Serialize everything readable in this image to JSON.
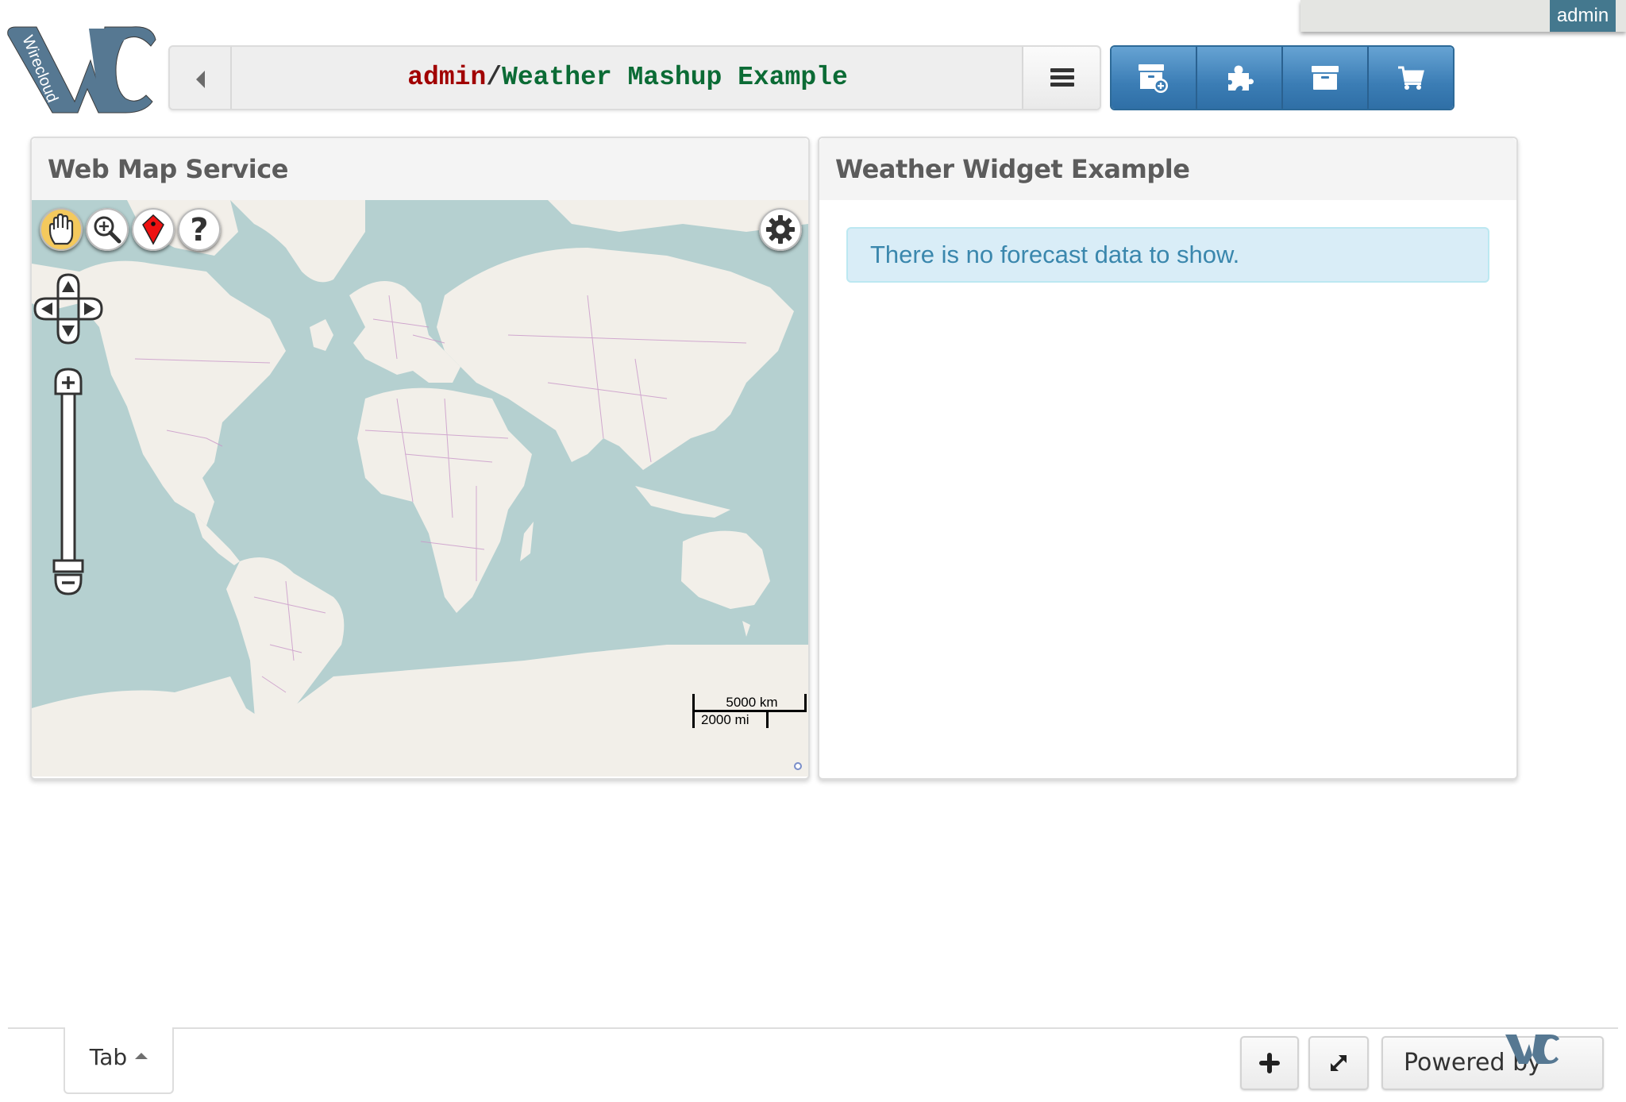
{
  "user_bar": {
    "username": "admin"
  },
  "logo": {
    "text": "Wirecloud",
    "icon": "wirecloud-logo"
  },
  "header": {
    "back_icon": "caret-left-icon",
    "owner": "admin",
    "separator": "/",
    "workspace": "Weather Mashup Example",
    "menu_icon": "hamburger-menu-icon",
    "toolbar": [
      {
        "name": "add-widget",
        "icon": "archive-add-icon"
      },
      {
        "name": "wiring",
        "icon": "puzzle-icon"
      },
      {
        "name": "my-resources",
        "icon": "archive-icon"
      },
      {
        "name": "marketplace",
        "icon": "shopping-cart-icon"
      }
    ]
  },
  "widgets": {
    "wms": {
      "title": "Web Map Service",
      "tools": [
        {
          "name": "pan",
          "icon": "hand-icon",
          "active": true
        },
        {
          "name": "zoom-box",
          "icon": "zoom-in-icon",
          "active": false
        },
        {
          "name": "marker",
          "icon": "map-marker-icon",
          "active": false
        },
        {
          "name": "help",
          "icon": "question-icon",
          "active": false
        }
      ],
      "settings_icon": "gear-icon",
      "pan_controls": [
        "up",
        "left",
        "right",
        "down"
      ],
      "zoom_controls": {
        "in": "+",
        "out": "-",
        "level": 0
      },
      "scale": {
        "metric": "5000 km",
        "imperial": "2000 mi"
      },
      "colors": {
        "water": "#b5d0d0",
        "land": "#f2efe9",
        "borders": "#c896c8"
      }
    },
    "weather": {
      "title": "Weather Widget Example",
      "message": "There is no forecast data to show."
    }
  },
  "footer": {
    "tabs": [
      {
        "label": "Tab",
        "active": true
      }
    ],
    "add_tab_icon": "plus-icon",
    "fullscreen_icon": "expand-icon",
    "powered_by": "Powered by"
  },
  "colors": {
    "owner": "#a10000",
    "workspace": "#0b6b35",
    "toolbar_blue": "#3b7db5",
    "user_badge": "#44788e",
    "logo": "#567892",
    "alert_bg": "#d9edf7",
    "alert_text": "#3a87ad"
  }
}
